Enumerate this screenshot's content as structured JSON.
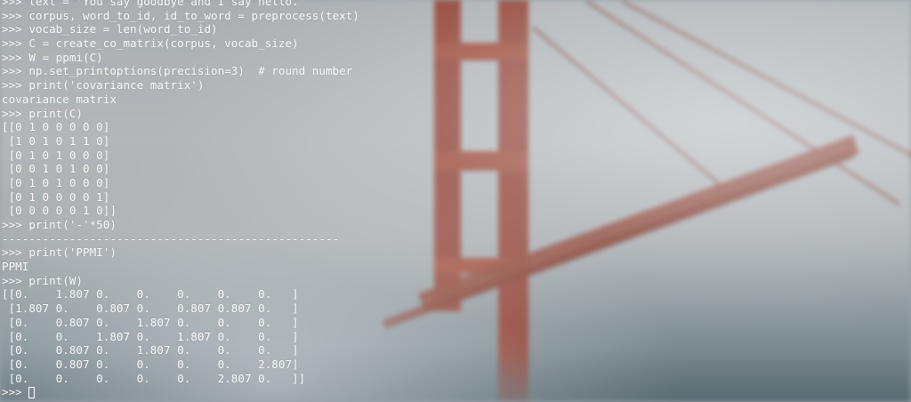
{
  "terminal": {
    "lines": [
      ">>> text = 'You say goodbye and I say hello.'",
      ">>> corpus, word_to_id, id_to_word = preprocess(text)",
      ">>> vocab_size = len(word_to_id)",
      ">>> C = create_co_matrix(corpus, vocab_size)",
      ">>> W = ppmi(C)",
      ">>> np.set_printoptions(precision=3)  # round number",
      ">>> print('covariance matrix')",
      "covariance matrix",
      ">>> print(C)",
      "[[0 1 0 0 0 0 0]",
      " [1 0 1 0 1 1 0]",
      " [0 1 0 1 0 0 0]",
      " [0 0 1 0 1 0 0]",
      " [0 1 0 1 0 0 0]",
      " [0 1 0 0 0 0 1]",
      " [0 0 0 0 0 1 0]]",
      ">>> print('-'*50)",
      "--------------------------------------------------",
      ">>> print('PPMI')",
      "PPMI",
      ">>> print(W)",
      "[[0.    1.807 0.    0.    0.    0.    0.   ]",
      " [1.807 0.    0.807 0.    0.807 0.807 0.   ]",
      " [0.    0.807 0.    1.807 0.    0.    0.   ]",
      " [0.    0.    1.807 0.    1.807 0.    0.   ]",
      " [0.    0.807 0.    1.807 0.    0.    0.   ]",
      " [0.    0.807 0.    0.    0.    0.    2.807]",
      " [0.    0.    0.    0.    0.    2.807 0.   ]]"
    ],
    "prompt": ">>> ",
    "text_color": "#ffffff"
  }
}
